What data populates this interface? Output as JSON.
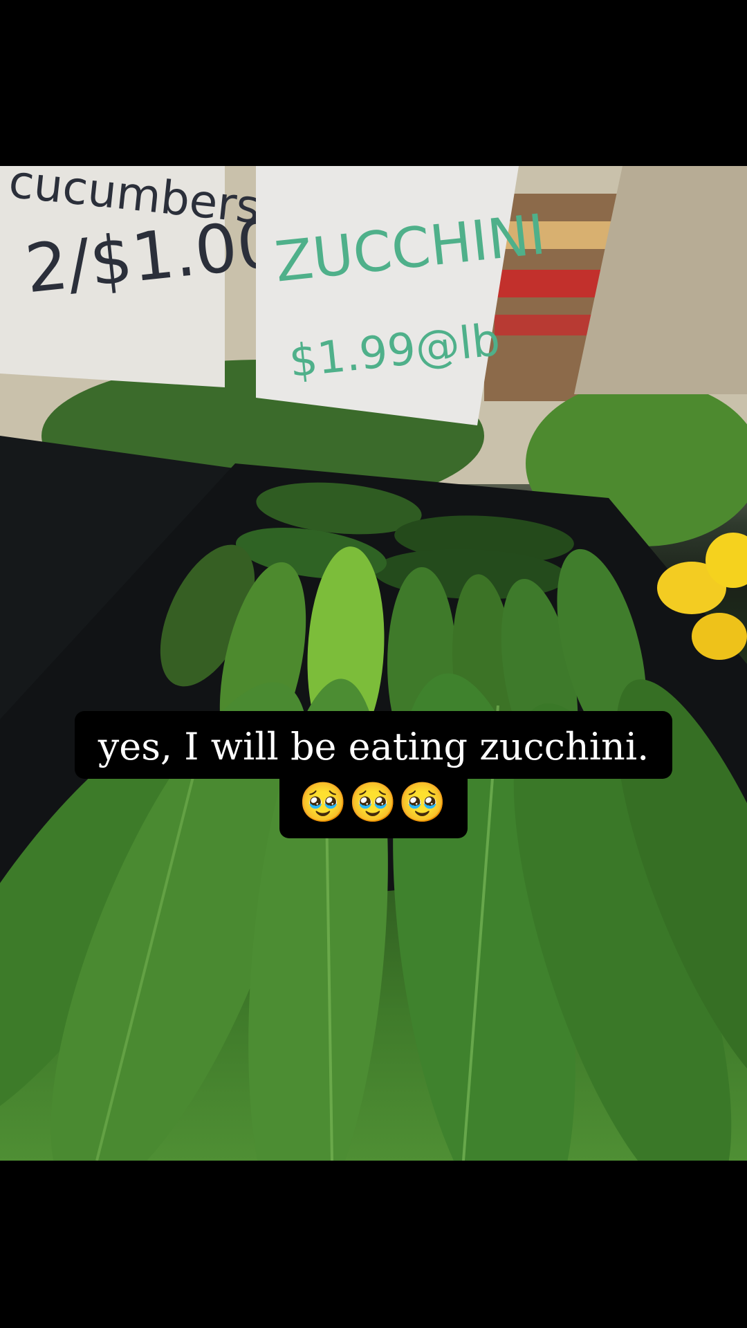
{
  "story": {
    "caption_line1": "yes, I will be eating zucchini.",
    "caption_line2": "🥹🥹🥹"
  },
  "photo": {
    "description_icon": "produce-photo",
    "signs": {
      "left": {
        "line1": "cucumbers",
        "line2": "2/$1.00"
      },
      "right": {
        "line1": "ZUCCHINI",
        "line2": "$1.99@lb"
      }
    }
  },
  "colors": {
    "background": "#000000",
    "caption_bg": "#000000",
    "caption_text": "#ffffff",
    "zucchini": "#3f7a2a",
    "sign_marker_green": "#4fb08a",
    "sign_marker_dark": "#2b2f3a"
  }
}
